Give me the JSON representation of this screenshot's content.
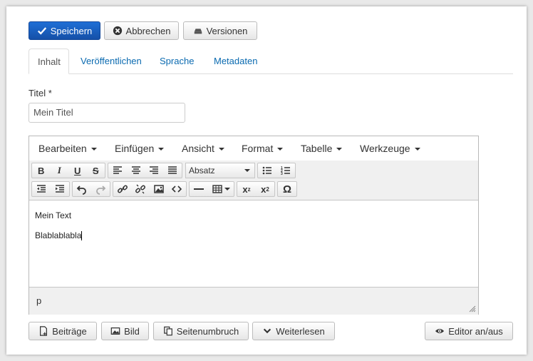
{
  "toolbar": {
    "save_label": "Speichern",
    "cancel_label": "Abbrechen",
    "versions_label": "Versionen"
  },
  "tabs": [
    {
      "label": "Inhalt",
      "active": true
    },
    {
      "label": "Veröffentlichen",
      "active": false
    },
    {
      "label": "Sprache",
      "active": false
    },
    {
      "label": "Metadaten",
      "active": false
    }
  ],
  "title_field": {
    "label": "Titel *",
    "value": "Mein Titel"
  },
  "editor": {
    "menus": [
      "Bearbeiten",
      "Einfügen",
      "Ansicht",
      "Format",
      "Tabelle",
      "Werkzeuge"
    ],
    "format_select": "Absatz",
    "content_lines": [
      "Mein Text",
      "Blablablabla"
    ],
    "status_path": "p"
  },
  "bottom_buttons": {
    "articles": "Beiträge",
    "image": "Bild",
    "pagebreak": "Seitenumbruch",
    "readmore": "Weiterlesen",
    "toggle_editor": "Editor an/aus"
  },
  "colors": {
    "primary": "#1a5fc2",
    "link": "#0a6ab0"
  }
}
